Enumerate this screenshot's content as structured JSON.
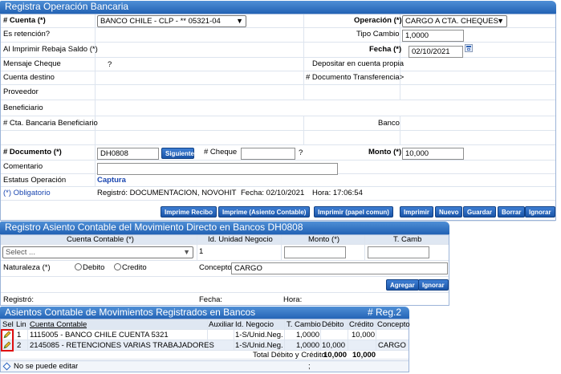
{
  "section1": {
    "title": "Registra Operación Bancaria",
    "cuenta_label": "# Cuenta (*)",
    "cuenta_value": "BANCO CHILE - CLP - ** 05321-04",
    "operacion_label": "Operación (*)",
    "operacion_value": "CARGO A CTA. CHEQUES",
    "retencion_label": "Es retención?",
    "tipo_cambio_label": "Tipo Cambio",
    "tipo_cambio_value": "1,0000",
    "rebaja_label": "Al Imprimir Rebaja Saldo (*)",
    "fecha_label": "Fecha (*)",
    "fecha_value": "02/10/2021",
    "mensaje_label": "Mensaje Cheque",
    "mensaje_value": "?",
    "depositar_label": "Depositar en cuenta propia",
    "cuenta_destino_label": "Cuenta destino",
    "doc_transf_label": "# Documento Transferencia>",
    "proveedor_label": "Proveedor",
    "beneficiario_label": "Beneficiario",
    "cta_benef_label": "# Cta. Bancaria Beneficiario",
    "banco_label": "Banco",
    "documento_label": "# Documento (*)",
    "documento_value": "DH0808",
    "siguiente_label": "Siguiente",
    "cheque_label": "# Cheque",
    "cheque_hint": "?",
    "monto_label": "Monto (*)",
    "monto_value": "10,000",
    "comentario_label": "Comentario",
    "estatus_label": "Estatus Operación",
    "estatus_value": "Captura",
    "obligatorio_label": "(*) Obligatorio",
    "registro_text": "Registró: DOCUMENTACION, NOVOHIT",
    "registro_fecha": "Fecha: 02/10/2021",
    "registro_hora": "Hora: 17:06:54",
    "buttons": [
      "Imprime Recibo",
      "Imprime (Asiento Contable)",
      "Imprimir (papel comun)",
      "Imprimir",
      "Nuevo",
      "Guardar",
      "Borrar",
      "Ignorar"
    ]
  },
  "section2": {
    "title": "Registro Asiento Contable del Movimiento Directo en Bancos DH0808",
    "col_cuenta": "Cuenta Contable (*)",
    "col_unidad": "Id. Unidad Negocio",
    "col_monto": "Monto (*)",
    "col_tcamb": "T. Camb",
    "cuenta_select": "Select ...",
    "unidad_value": "1",
    "naturaleza_label": "Naturaleza (*)",
    "debito_label": "Debito",
    "credito_label": "Credito",
    "concepto_label": "Concepto",
    "concepto_value": "CARGO",
    "agregar_label": "Agregar",
    "ignorar_label": "Ignorar",
    "registro_label": "Registró:",
    "fecha_label": "Fecha:",
    "hora_label": "Hora:"
  },
  "section3": {
    "title": "Asientos Contable de Movimientos Registrados en Bancos",
    "reg_count": "# Reg.2",
    "columns": [
      "Sel",
      "Lin",
      "Cuenta Contable",
      "Auxiliar",
      "Id. Negocio",
      "T. Cambio",
      "Débito",
      "Crédito",
      "Concepto"
    ],
    "rows": [
      {
        "lin": "1",
        "cuenta": "1115005 - BANCO CHILE CUENTA 5321",
        "auxiliar": "",
        "negocio": "1-S/Unid.Neg.",
        "tcambio": "1,0000",
        "debito": "",
        "credito": "10,000",
        "concepto": ""
      },
      {
        "lin": "2",
        "cuenta": "2145085 - RETENCIONES VARIAS TRABAJADORES",
        "auxiliar": "",
        "negocio": "1-S/Unid.Neg.",
        "tcambio": "1,0000",
        "debito": "10,000",
        "credito": "",
        "concepto": "CARGO"
      }
    ],
    "total_label": "Total Débito y Crédito",
    "total_debito": "10,000",
    "total_credito": "10,000",
    "status_text": "No se puede editar",
    "status_right": ";"
  },
  "colors": {
    "header": "#2262b4",
    "button": "#1a55a8",
    "accent_blue": "#1a46b0",
    "highlight_red": "#e01010"
  }
}
